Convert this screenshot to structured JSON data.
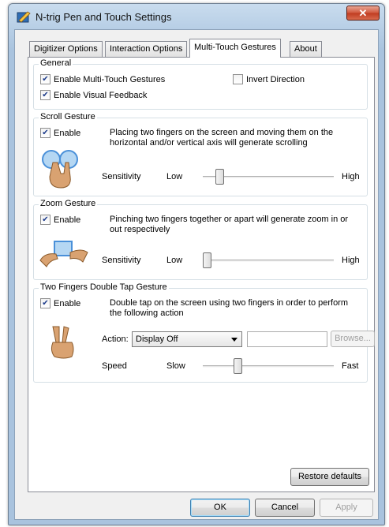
{
  "window": {
    "title": "N-trig Pen and Touch Settings",
    "close_label": "✕"
  },
  "tabs": [
    {
      "label": "Digitizer Options"
    },
    {
      "label": "Interaction Options"
    },
    {
      "label": "Multi-Touch Gestures"
    },
    {
      "label": "About"
    }
  ],
  "active_tab": "Multi-Touch Gestures",
  "general": {
    "title": "General",
    "enable_multitouch": {
      "label": "Enable Multi-Touch Gestures",
      "checked": true
    },
    "invert_direction": {
      "label": "Invert Direction",
      "checked": false
    },
    "visual_feedback": {
      "label": "Enable Visual Feedback",
      "checked": true
    }
  },
  "scroll": {
    "title": "Scroll Gesture",
    "enable_label": "Enable",
    "enabled": true,
    "description": "Placing two fingers on the screen and moving them on the horizontal and/or vertical axis will generate scrolling",
    "sensitivity_label": "Sensitivity",
    "low_label": "Low",
    "high_label": "High",
    "sensitivity_level": 0.1
  },
  "zoom": {
    "title": "Zoom Gesture",
    "enable_label": "Enable",
    "enabled": true,
    "description": "Pinching two fingers together or apart will generate zoom in or out respectively",
    "sensitivity_label": "Sensitivity",
    "low_label": "Low",
    "high_label": "High",
    "sensitivity_level": 0.0
  },
  "double_tap": {
    "title": "Two Fingers Double Tap Gesture",
    "enable_label": "Enable",
    "enabled": true,
    "description": "Double tap on the screen using two fingers in order to perform the following action",
    "action_label": "Action:",
    "action_value": "Display Off",
    "path_value": "",
    "browse_label": "Browse...",
    "speed_label": "Speed",
    "slow_label": "Slow",
    "fast_label": "Fast",
    "speed_level": 0.25
  },
  "buttons": {
    "restore_defaults": "Restore defaults",
    "ok": "OK",
    "cancel": "Cancel",
    "apply": "Apply"
  },
  "colors": {
    "accent_blue": "#4a90d9",
    "skin": "#d9a271",
    "check": "#1b3a8a"
  }
}
